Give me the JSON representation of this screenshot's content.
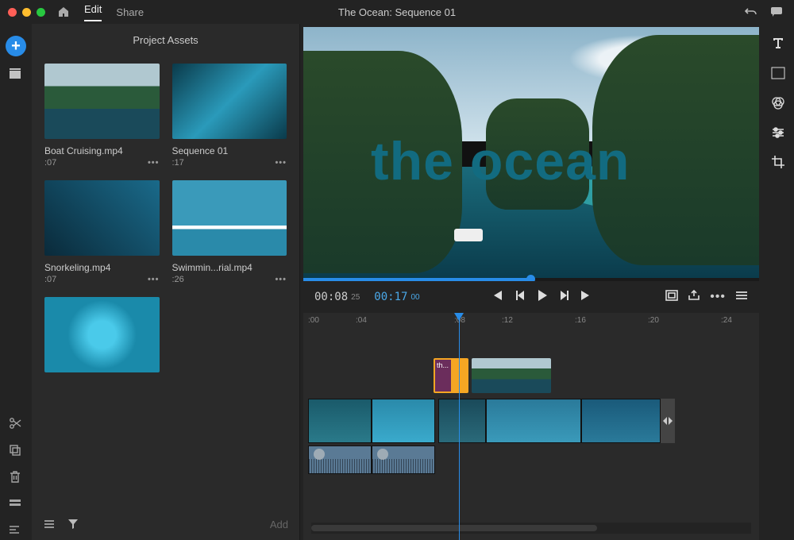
{
  "titlebar": {
    "nav": {
      "edit": "Edit",
      "share": "Share"
    },
    "title": "The Ocean: Sequence 01"
  },
  "assets": {
    "header": "Project Assets",
    "items": [
      {
        "name": "Boat Cruising.mp4",
        "dur": ":07"
      },
      {
        "name": "Sequence 01",
        "dur": ":17"
      },
      {
        "name": "Snorkeling.mp4",
        "dur": ":07"
      },
      {
        "name": "Swimmin...rial.mp4",
        "dur": ":26"
      },
      {
        "name": "",
        "dur": ""
      }
    ],
    "footer": {
      "add": "Add"
    }
  },
  "preview": {
    "overlay": "the ocean",
    "time": "00:08",
    "time_sub": "25",
    "dur": "00:17",
    "dur_sub": "00"
  },
  "ruler": {
    "t0": ":00",
    "t1": ":04",
    "t2": ":08",
    "t3": ":12",
    "t4": ":16",
    "t5": ":20",
    "t6": ":24"
  },
  "timeline": {
    "title_clip": "th..."
  }
}
